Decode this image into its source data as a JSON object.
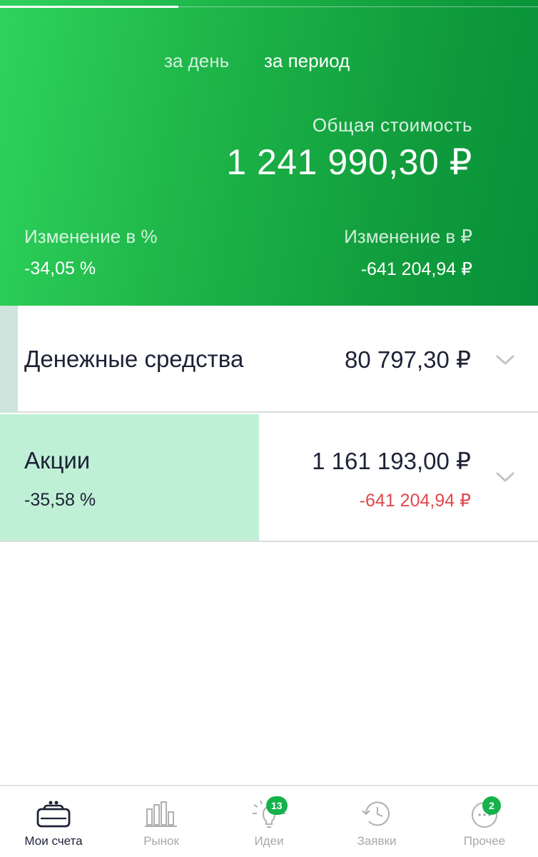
{
  "header": {
    "period_tabs": [
      {
        "label": "за день",
        "active": false
      },
      {
        "label": "за период",
        "active": true
      }
    ],
    "total_label": "Общая стоимость",
    "total_value": "1 241 990,30 ₽",
    "change_percent_label": "Изменение в  %",
    "change_percent_value": "-34,05  %",
    "change_rub_label": "Изменение в ₽",
    "change_rub_value": "-641 204,94 ₽",
    "colors": {
      "gradient_start": "#2fd35c",
      "gradient_end": "#07903a"
    }
  },
  "accounts": [
    {
      "name": "Денежные средства",
      "value": "80 797,30 ₽",
      "icon": "chevron-down-icon"
    },
    {
      "name": "Акции",
      "percent": "-35,58  %",
      "value": "1 161 193,00 ₽",
      "change": "-641 204,94 ₽",
      "change_color": "#e2474f",
      "icon": "chevron-down-icon"
    }
  ],
  "bottom_nav": {
    "items": [
      {
        "label": "Мои счета",
        "icon": "wallet-icon",
        "active": true
      },
      {
        "label": "Рынок",
        "icon": "bar-chart-icon",
        "active": false
      },
      {
        "label": "Идеи",
        "icon": "lightbulb-icon",
        "active": false,
        "badge": "13"
      },
      {
        "label": "Заявки",
        "icon": "history-clock-icon",
        "active": false
      },
      {
        "label": "Прочее",
        "icon": "more-dots-icon",
        "active": false,
        "badge": "2"
      }
    ],
    "badge_color": "#15b24b"
  }
}
